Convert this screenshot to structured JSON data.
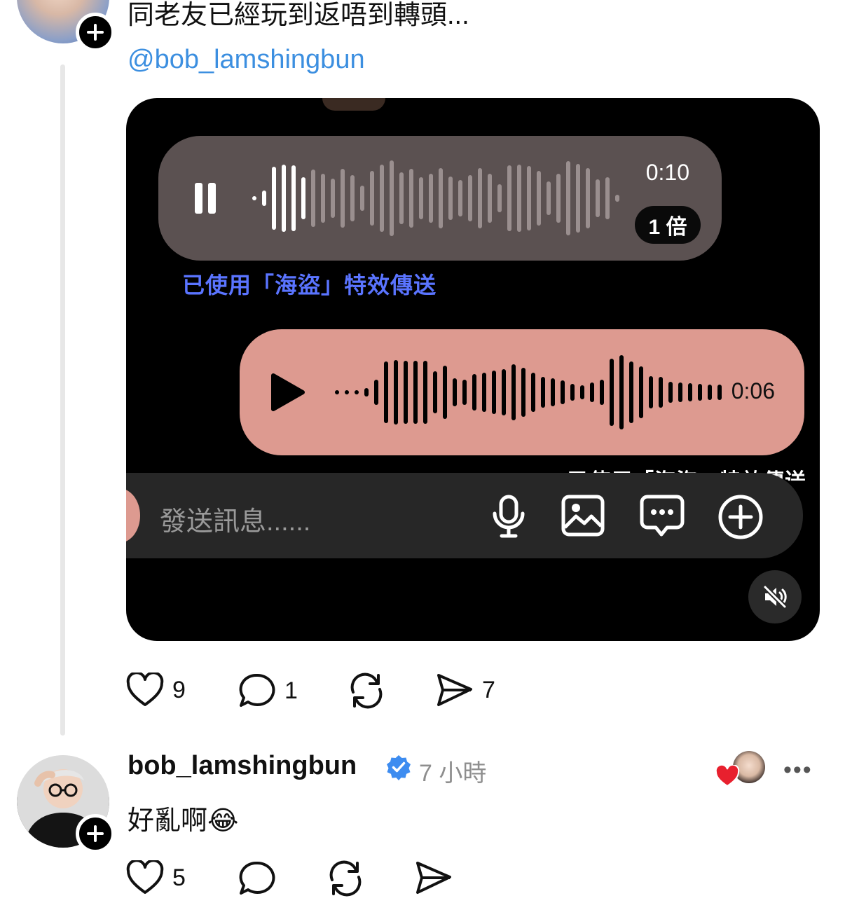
{
  "post": {
    "text": "同老友已經玩到返唔到轉頭...",
    "mention": "@bob_lamshingbun",
    "media": {
      "voice_received": {
        "duration": "0:10",
        "speed": "1 倍",
        "progress": 0.12
      },
      "effect_label_received": "已使用「海盜」特效傳送",
      "voice_sent": {
        "duration": "0:06"
      },
      "effect_label_sent": "已使用「海盜」特效傳送",
      "input_placeholder": "發送訊息......"
    },
    "actions": {
      "likes": "9",
      "comments": "1",
      "reposts": "",
      "shares": "7"
    }
  },
  "reply": {
    "username": "bob_lamshingbun",
    "verified": true,
    "time": "7 小時",
    "text": "好亂啊",
    "emoji": "😂",
    "actions": {
      "likes": "5",
      "comments": "",
      "reposts": "",
      "shares": ""
    }
  },
  "colors": {
    "mention": "#3c8fe0",
    "verified": "#3d8cf0",
    "voice_received_bg": "#5b5151",
    "voice_sent_bg": "#dd9a90",
    "effect_blue": "#5a74ff",
    "like_heart": "#e8202e"
  },
  "icons": [
    "follow-plus-icon",
    "pause-icon",
    "play-icon",
    "microphone-icon",
    "image-icon",
    "chat-bubble-icon",
    "add-circle-icon",
    "mute-icon",
    "heart-icon",
    "comment-icon",
    "repost-icon",
    "share-icon",
    "verified-badge-icon",
    "more-icon"
  ]
}
